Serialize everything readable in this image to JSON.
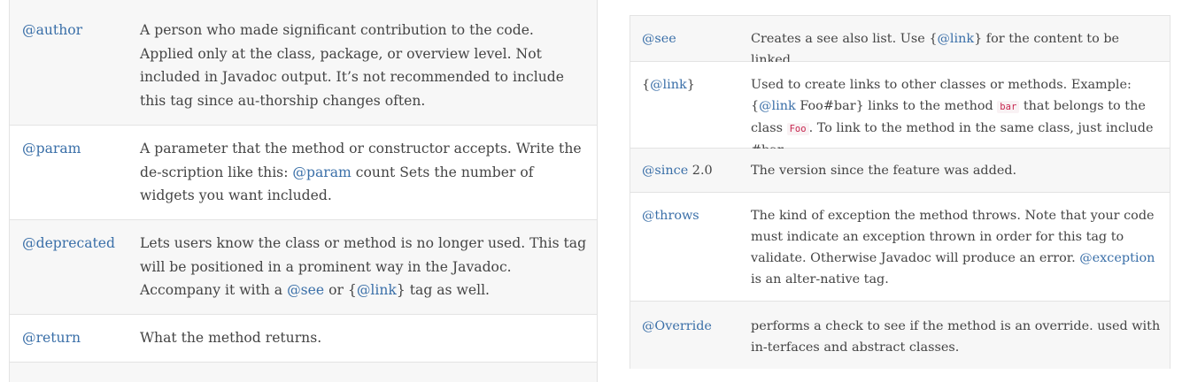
{
  "left_table": {
    "rows": [
      {
        "tag": "@author",
        "desc": "A person who made significant contribution to the code. Applied only at the class, package, or overview level. Not included in Javadoc output. It’s not recommended to include this tag since au-thorship changes often."
      },
      {
        "tag": "@param",
        "desc_before": "A parameter that the method or constructor accepts. Write the de-scription like this: ",
        "desc_link": "@param",
        "desc_after": " count Sets the number of widgets you want included."
      },
      {
        "tag": "@deprecated",
        "desc_before": "Lets users know the class or method is no longer used. This tag will be positioned in a prominent way in the Javadoc. Accompany it with a ",
        "desc_link1": "@see",
        "desc_mid": " or {",
        "desc_link2": "@link",
        "desc_after": "} tag as well."
      },
      {
        "tag": "@return",
        "desc": "What the method returns."
      }
    ]
  },
  "right_table": {
    "rows": [
      {
        "tag": "@see",
        "desc_before": "Creates a see also list. Use {",
        "desc_link": "@link",
        "desc_after": "} for the content to be linked."
      },
      {
        "tag_prefix": "{",
        "tag": "@link",
        "tag_suffix": "}",
        "desc_before": "Used to create links to other classes or methods. Example: {",
        "desc_link": "@link",
        "desc_mid1": " Foo#bar} links to the method ",
        "desc_code1": "bar",
        "desc_mid2": " that belongs to the class ",
        "desc_code2": "Foo",
        "desc_after": ". To link to the method in the same class, just include #bar."
      },
      {
        "tag": "@since",
        "tag_suffix": " 2.0",
        "desc": "The version since the feature was added."
      },
      {
        "tag": "@throws",
        "desc_before": "The kind of exception the method throws. Note that your code must indicate an exception thrown in order for this tag to validate. Otherwise Javadoc will produce an error. ",
        "desc_link": "@exception",
        "desc_after": " is an alter-native tag."
      },
      {
        "tag": "@Override",
        "desc": "performs a check to see if the method is an override. used with in-terfaces and abstract classes."
      }
    ]
  }
}
